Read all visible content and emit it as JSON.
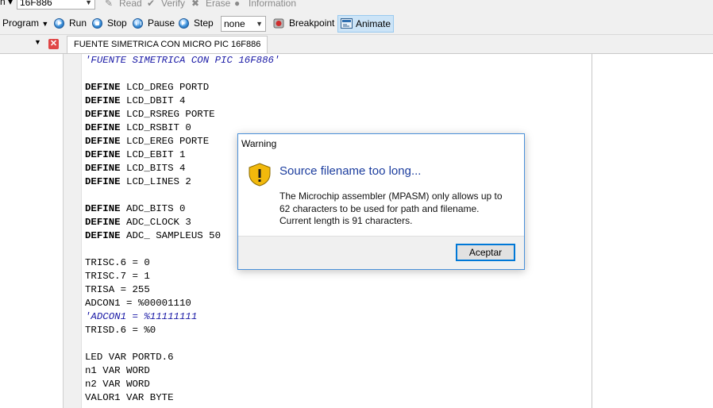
{
  "toolbar_top": {
    "chip_combo_value": "16F886",
    "read_label": "Read",
    "verify_label": "Verify",
    "erase_label": "Erase",
    "information_label": "Information"
  },
  "toolbar_main": {
    "program_label": "Program",
    "run_label": "Run",
    "stop_label": "Stop",
    "pause_label": "Pause",
    "step_label": "Step",
    "step_mode_value": "none",
    "breakpoint_label": "Breakpoint",
    "animate_label": "Animate"
  },
  "editor": {
    "tab_title": "FUENTE SIMETRICA CON MICRO PIC 16F886",
    "lines": [
      {
        "kw": "",
        "text": "'FUENTE SIMETRICA CON PIC 16F886'",
        "comment": true
      },
      {
        "kw": "",
        "text": "",
        "comment": false
      },
      {
        "kw": "DEFINE",
        "text": " LCD_DREG PORTD",
        "comment": false
      },
      {
        "kw": "DEFINE",
        "text": " LCD_DBIT 4",
        "comment": false
      },
      {
        "kw": "DEFINE",
        "text": " LCD_RSREG PORTE",
        "comment": false
      },
      {
        "kw": "DEFINE",
        "text": " LCD_RSBIT 0",
        "comment": false
      },
      {
        "kw": "DEFINE",
        "text": " LCD_EREG PORTE",
        "comment": false
      },
      {
        "kw": "DEFINE",
        "text": " LCD_EBIT 1",
        "comment": false
      },
      {
        "kw": "DEFINE",
        "text": " LCD_BITS 4",
        "comment": false
      },
      {
        "kw": "DEFINE",
        "text": " LCD_LINES 2",
        "comment": false
      },
      {
        "kw": "",
        "text": "",
        "comment": false
      },
      {
        "kw": "DEFINE",
        "text": " ADC_BITS 0",
        "comment": false
      },
      {
        "kw": "DEFINE",
        "text": " ADC_CLOCK 3",
        "comment": false
      },
      {
        "kw": "DEFINE",
        "text": " ADC_ SAMPLEUS 50",
        "comment": false
      },
      {
        "kw": "",
        "text": "",
        "comment": false
      },
      {
        "kw": "",
        "text": "TRISC.6 = 0",
        "comment": false
      },
      {
        "kw": "",
        "text": "TRISC.7 = 1",
        "comment": false
      },
      {
        "kw": "",
        "text": "TRISA = 255",
        "comment": false
      },
      {
        "kw": "",
        "text": "ADCON1 = %00001110",
        "comment": false
      },
      {
        "kw": "",
        "text": "'ADCON1 = %11111111",
        "comment": true
      },
      {
        "kw": "",
        "text": "TRISD.6 = %0",
        "comment": false
      },
      {
        "kw": "",
        "text": "",
        "comment": false
      },
      {
        "kw": "",
        "text": "LED VAR PORTD.6",
        "comment": false
      },
      {
        "kw": "",
        "text": "n1 VAR WORD",
        "comment": false
      },
      {
        "kw": "",
        "text": "n2 VAR WORD",
        "comment": false
      },
      {
        "kw": "",
        "text": "VALOR1 VAR BYTE",
        "comment": false
      }
    ]
  },
  "dialog": {
    "title": "Warning",
    "heading": "Source filename too long...",
    "body": "The Microchip assembler (MPASM) only allows up to 62 characters to be used for path and filename. Current length is 91 characters.",
    "ok_label": "Aceptar",
    "icon": "warning-shield-icon"
  },
  "colors": {
    "accent": "#0078d7",
    "heading": "#1c3d9e",
    "comment": "#1a1aa6",
    "warning_icon": "#f2b90c"
  }
}
